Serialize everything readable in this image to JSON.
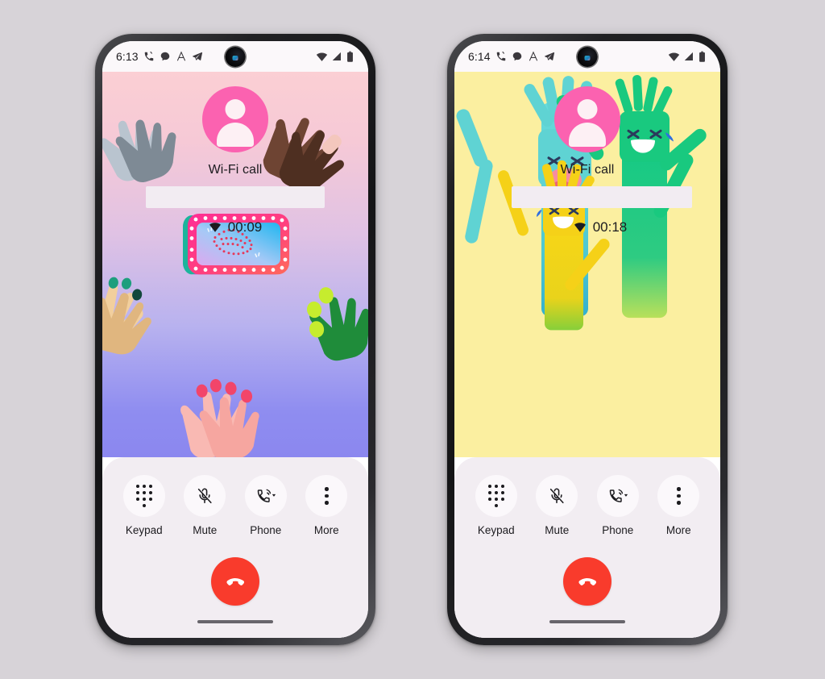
{
  "page": {
    "background_color": "#d7d3d8",
    "description": "Two Android phone screenshots side by side showing an in-progress Wi-Fi call screen with animated background effects"
  },
  "phones": [
    {
      "id": "phone-left",
      "status_bar": {
        "time": "6:13",
        "left_icons": [
          "call-icon",
          "message-bubble-icon",
          "font-size-icon",
          "telegram-send-icon"
        ],
        "right_icons": [
          "wifi-icon",
          "signal-icon",
          "battery-icon"
        ],
        "camera": "front-camera-punchhole"
      },
      "call": {
        "avatar_icon": "person-avatar-icon",
        "avatar_color": "#fb62b0",
        "call_type": "Wi-Fi call",
        "contact_name_redacted": true,
        "duration": "00:09",
        "duration_icon": "wifi-calling-icon"
      },
      "background": {
        "theme": "clapping-hands-effect",
        "colors": [
          "#fbcfd4",
          "#b8b2ef",
          "#8b87ef"
        ],
        "accent_sign_colors": [
          "#ff3d8b",
          "#6ad2f5",
          "#c08bf0"
        ]
      },
      "controls": [
        {
          "label": "Keypad",
          "icon": "dialpad-icon",
          "active": false
        },
        {
          "label": "Mute",
          "icon": "mic-off-icon",
          "active": false
        },
        {
          "label": "Phone",
          "icon": "audio-output-icon",
          "active": false,
          "has_caret": true
        },
        {
          "label": "More",
          "icon": "more-vertical-icon",
          "active": false
        }
      ],
      "end_call": {
        "label": "End call",
        "icon": "end-call-icon",
        "color": "#f93b2c"
      },
      "navigation": {
        "type": "gesture-pill"
      }
    },
    {
      "id": "phone-right",
      "status_bar": {
        "time": "6:14",
        "left_icons": [
          "call-icon",
          "message-bubble-icon",
          "font-size-icon",
          "telegram-send-icon"
        ],
        "right_icons": [
          "wifi-icon",
          "signal-icon",
          "battery-icon"
        ],
        "camera": "front-camera-punchhole"
      },
      "call": {
        "avatar_icon": "person-avatar-icon",
        "avatar_color": "#fb62b0",
        "call_type": "Wi-Fi call",
        "contact_name_redacted": true,
        "duration": "00:18",
        "duration_icon": "wifi-calling-icon"
      },
      "background": {
        "theme": "laughing-tube-men-effect",
        "colors": [
          "#fbefa0",
          "#5fd3d3",
          "#f5d118",
          "#19c97f"
        ]
      },
      "controls": [
        {
          "label": "Keypad",
          "icon": "dialpad-icon",
          "active": false
        },
        {
          "label": "Mute",
          "icon": "mic-off-icon",
          "active": false
        },
        {
          "label": "Phone",
          "icon": "audio-output-icon",
          "active": false,
          "has_caret": true
        },
        {
          "label": "More",
          "icon": "more-vertical-icon",
          "active": false
        }
      ],
      "end_call": {
        "label": "End call",
        "icon": "end-call-icon",
        "color": "#f93b2c"
      },
      "navigation": {
        "type": "gesture-pill"
      }
    }
  ]
}
